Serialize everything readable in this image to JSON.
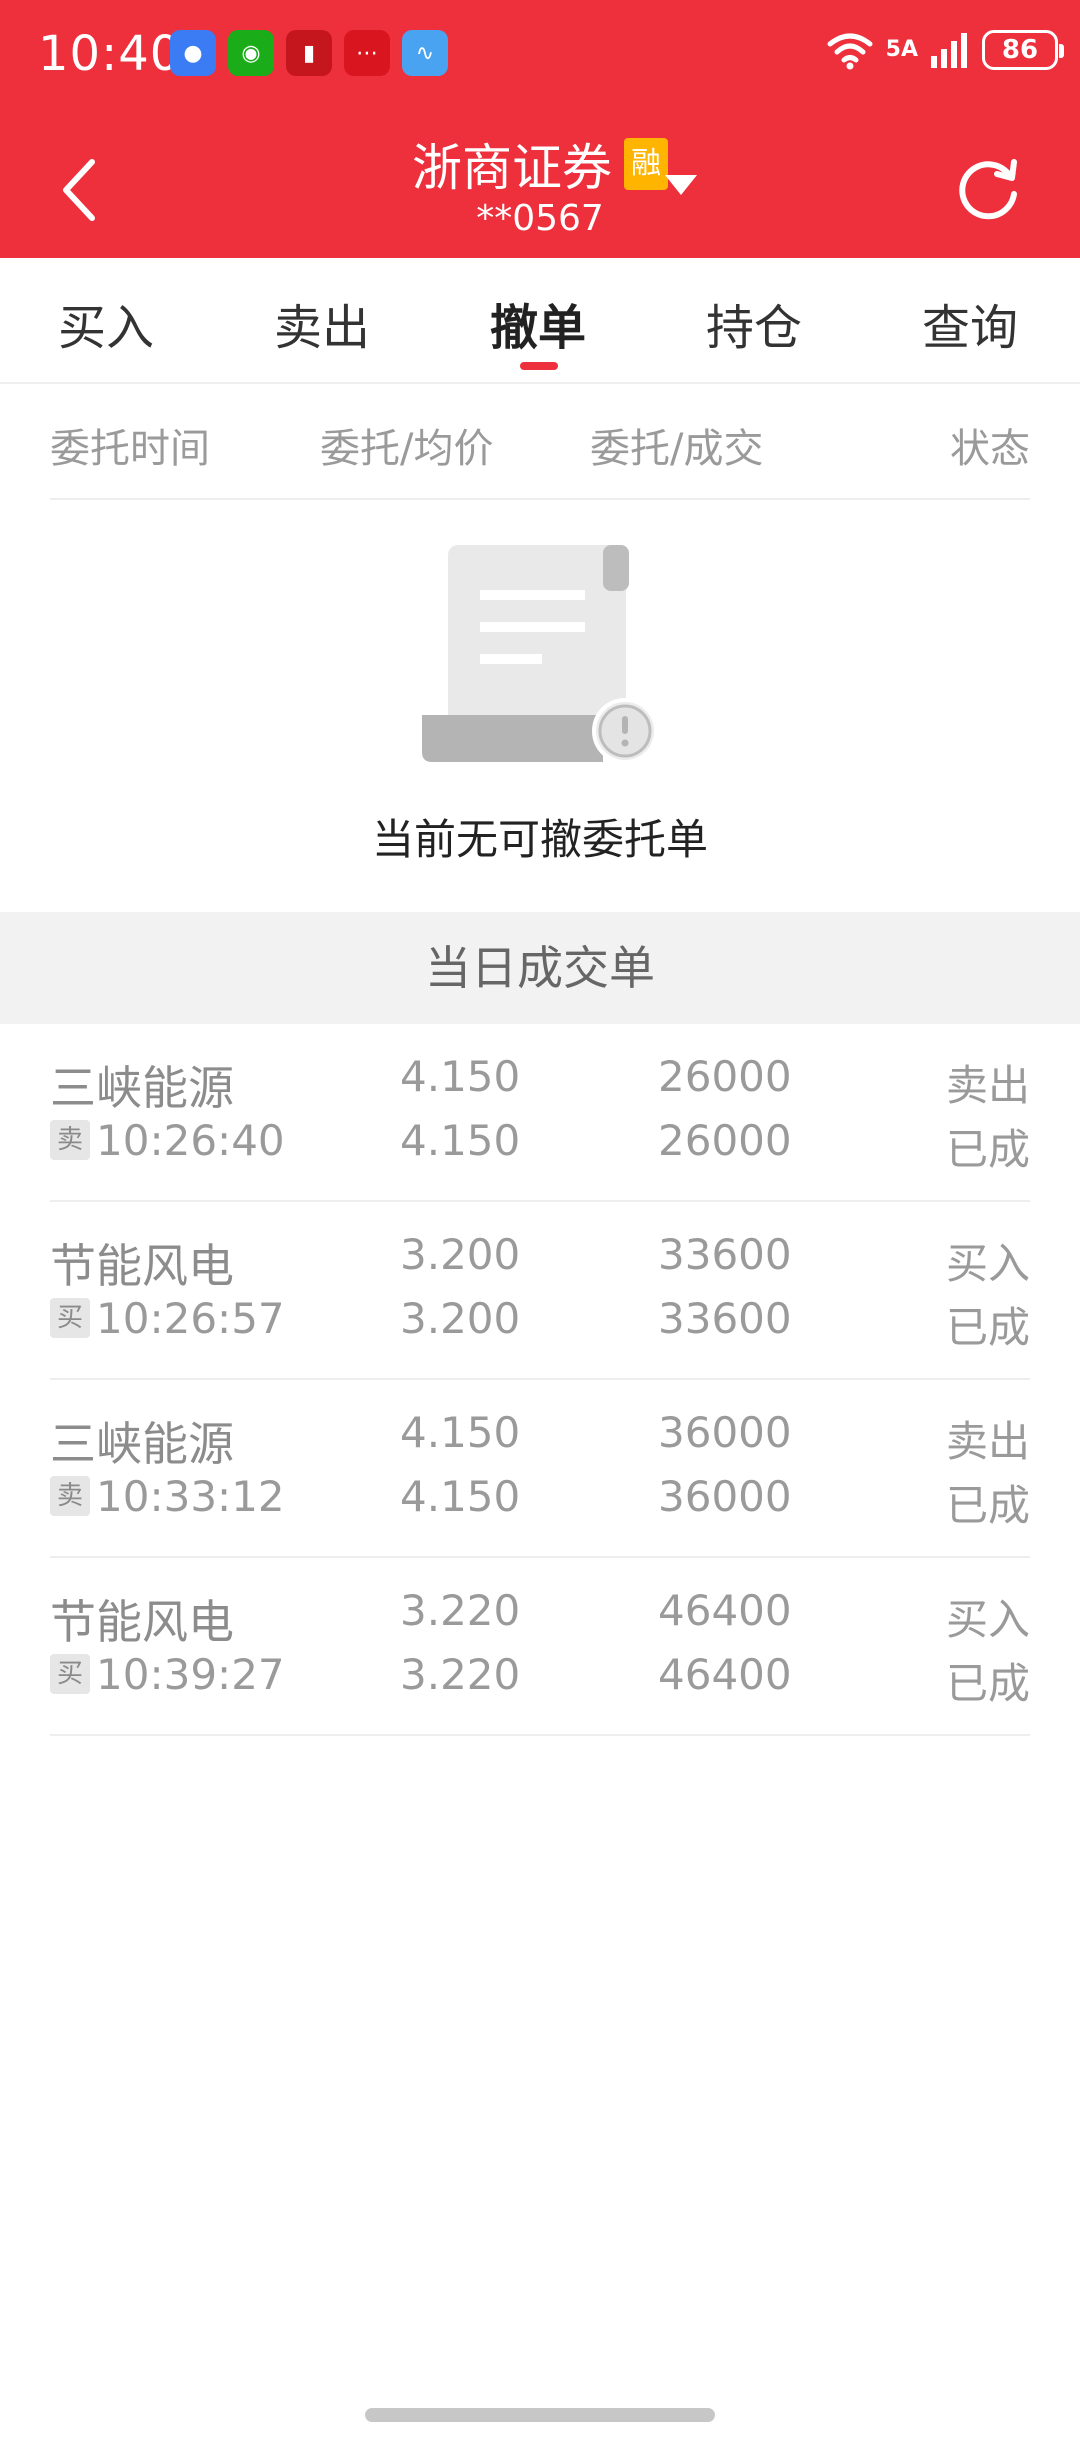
{
  "status_bar": {
    "time": "10:40",
    "network": "5A",
    "battery": "86",
    "app_icons": [
      "messages-icon",
      "wechat-icon",
      "app-red-icon",
      "app-chart-icon",
      "stocks-icon"
    ]
  },
  "header": {
    "title": "浙商证券",
    "badge": "融",
    "account": "**0567"
  },
  "tabs": [
    {
      "label": "买入"
    },
    {
      "label": "卖出"
    },
    {
      "label": "撤单"
    },
    {
      "label": "持仓"
    },
    {
      "label": "查询"
    }
  ],
  "active_tab": "撤单",
  "columns": [
    "委托时间",
    "委托/均价",
    "委托/成交",
    "状态"
  ],
  "empty_message": "当前无可撤委托单",
  "section_title": "当日成交单",
  "deals": [
    {
      "name": "三峡能源",
      "side": "卖",
      "time": "10:26:40",
      "price": "4.150",
      "avg_price": "4.150",
      "qty": "26000",
      "filled": "26000",
      "action": "卖出",
      "status": "已成"
    },
    {
      "name": "节能风电",
      "side": "买",
      "time": "10:26:57",
      "price": "3.200",
      "avg_price": "3.200",
      "qty": "33600",
      "filled": "33600",
      "action": "买入",
      "status": "已成"
    },
    {
      "name": "三峡能源",
      "side": "卖",
      "time": "10:33:12",
      "price": "4.150",
      "avg_price": "4.150",
      "qty": "36000",
      "filled": "36000",
      "action": "卖出",
      "status": "已成"
    },
    {
      "name": "节能风电",
      "side": "买",
      "time": "10:39:27",
      "price": "3.220",
      "avg_price": "3.220",
      "qty": "46400",
      "filled": "46400",
      "action": "买入",
      "status": "已成"
    }
  ],
  "colors": {
    "brand": "#ee2f3c",
    "badge": "#ffb400"
  }
}
